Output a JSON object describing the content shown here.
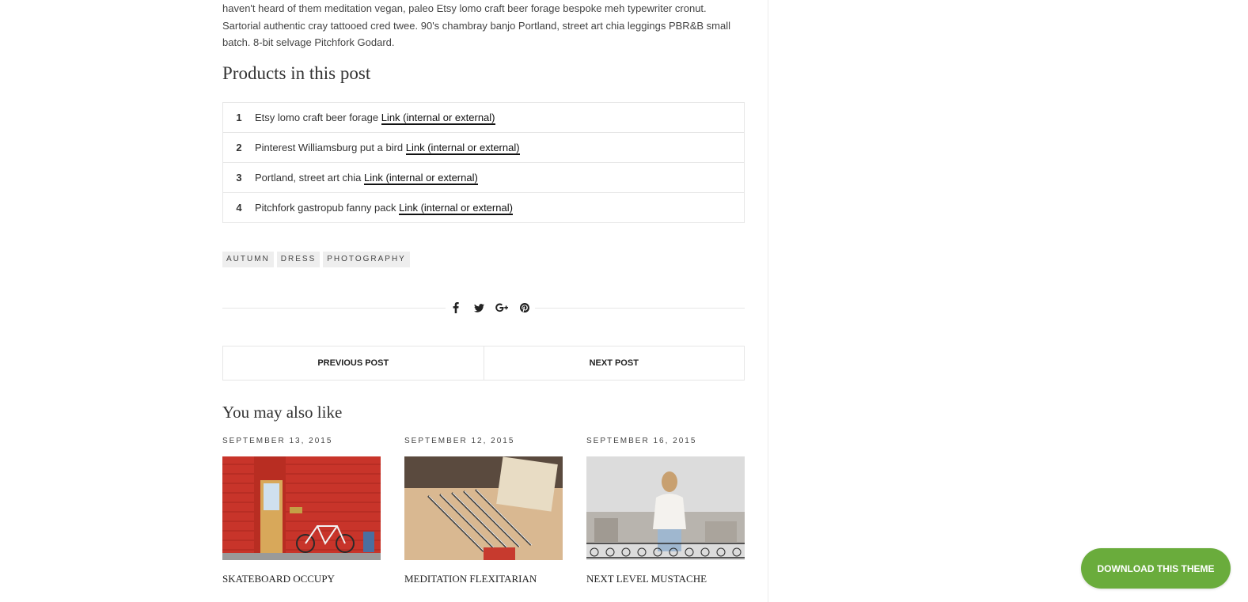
{
  "intro": {
    "text": "haven't heard of them meditation vegan, paleo Etsy lomo craft beer forage bespoke meh typewriter cronut. Sartorial authentic cray tattooed cred twee. 90's chambray banjo Portland, street art chia leggings PBR&B small batch. 8-bit selvage Pitchfork Godard."
  },
  "products": {
    "heading": "Products in this post",
    "items": [
      {
        "num": "1",
        "text": "Etsy lomo craft beer forage",
        "link": "Link (internal or external)"
      },
      {
        "num": "2",
        "text": "Pinterest Williamsburg put a bird",
        "link": "Link (internal or external)"
      },
      {
        "num": "3",
        "text": "Portland, street art chia",
        "link": "Link (internal or external)"
      },
      {
        "num": "4",
        "text": "Pitchfork gastropub fanny pack",
        "link": "Link (internal or external)"
      }
    ]
  },
  "tags": [
    "AUTUMN",
    "DRESS",
    "PHOTOGRAPHY"
  ],
  "share": {
    "icons": [
      "facebook-icon",
      "twitter-icon",
      "google-plus-icon",
      "pinterest-icon"
    ],
    "glyphs": [
      "f",
      "t",
      "G+",
      "p"
    ]
  },
  "post_nav": {
    "previous_label": "PREVIOUS POST",
    "next_label": "NEXT POST"
  },
  "related": {
    "heading": "You may also like",
    "posts": [
      {
        "date": "SEPTEMBER 13, 2015",
        "title": "SKATEBOARD OCCUPY"
      },
      {
        "date": "SEPTEMBER 12, 2015",
        "title": "MEDITATION FLEXITARIAN"
      },
      {
        "date": "SEPTEMBER 16, 2015",
        "title": "NEXT LEVEL MUSTACHE"
      }
    ]
  },
  "download": {
    "label": "DOWNLOAD THIS THEME",
    "color": "#6aac3c"
  }
}
